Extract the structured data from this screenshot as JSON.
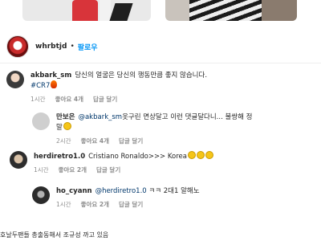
{
  "post": {
    "author": "whrbtjd",
    "follow_label": "팔로우",
    "separator": "•"
  },
  "comments": [
    {
      "username": "akbark_sm",
      "text": "당신의 얼굴은 당신의 행동만큼 좋지 않습니다.",
      "text_line2": "#CR7",
      "time": "1시간",
      "likes": "좋아요 4개",
      "reply_label": "답글 달기"
    },
    {
      "username": "만보은",
      "mention": "@akbark_sm",
      "text": "옷구린 면상달고 이런 댓글달다니... 불쌍해 정말",
      "time": "2시간",
      "likes": "좋아요 4개",
      "reply_label": "답글 달기"
    },
    {
      "username": "herdiretro1.0",
      "text": "Cristiano Ronaldo>>> Korea",
      "time": "1시간",
      "likes": "좋아요 2개",
      "reply_label": "답글 달기"
    },
    {
      "username": "ho_cyann",
      "mention": "@herdiretro1.0",
      "text": "ㅋㅋ 2대1 알해노",
      "time": "1시간",
      "likes": "좋아요 2개",
      "reply_label": "답글 달기"
    }
  ],
  "caption": "호날두팬들 총출동해서 조규성 까고 있음",
  "icons": {
    "emoji": "grinning-face-icon",
    "fire": "fire-icon"
  }
}
